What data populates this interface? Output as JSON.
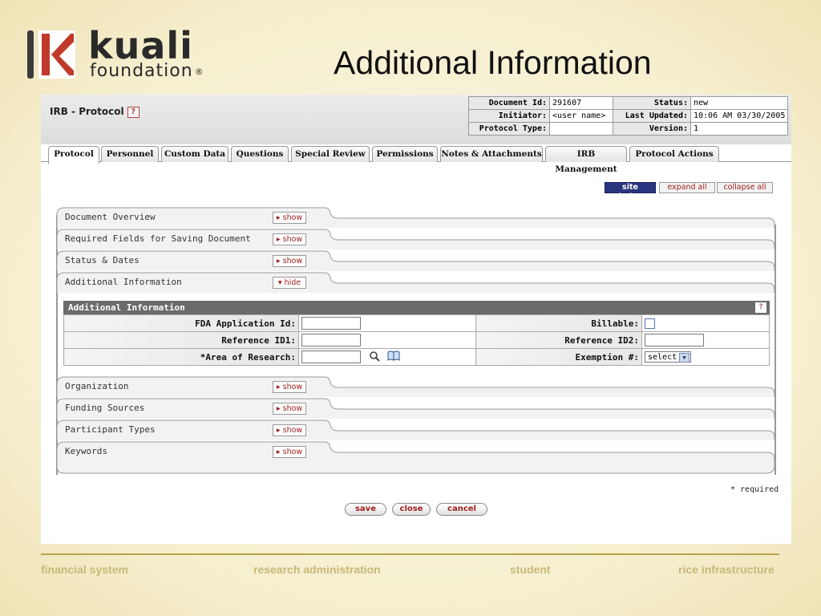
{
  "logo": {
    "brand": "kuali",
    "sub": "foundation",
    "reg": "®"
  },
  "slide_title": "Additional Information",
  "document": {
    "title": "IRB - Protocol",
    "help": "?",
    "info": [
      {
        "label": "Document Id:",
        "value": "291607",
        "label2": "Status:",
        "value2": "new"
      },
      {
        "label": "Initiator:",
        "value": "<user name>",
        "label2": "Last Updated:",
        "value2": "10:06 AM 03/30/2005"
      },
      {
        "label": "Protocol Type:",
        "value": "",
        "label2": "Version:",
        "value2": "1"
      }
    ]
  },
  "tabs": [
    "Protocol",
    "Personnel",
    "Custom Data",
    "Questions",
    "Special Review",
    "Permissions",
    "Notes & Attachments",
    "IRB Management",
    "Protocol Actions"
  ],
  "top_buttons": {
    "site_index": "site index",
    "expand_all": "expand all",
    "collapse_all": "collapse all"
  },
  "sections": [
    {
      "label": "Document Overview",
      "toggle": "▸ show"
    },
    {
      "label": "Required Fields for Saving Document",
      "toggle": "▸ show"
    },
    {
      "label": "Status & Dates",
      "toggle": "▸ show"
    },
    {
      "label": "Additional Information",
      "toggle": "▾ hide"
    },
    {
      "label": "Organization",
      "toggle": "▸ show"
    },
    {
      "label": "Funding Sources",
      "toggle": "▸ show"
    },
    {
      "label": "Participant Types",
      "toggle": "▸ show"
    },
    {
      "label": "Keywords",
      "toggle": "▸ show"
    }
  ],
  "additional_info": {
    "title": "Additional Information",
    "help": "?",
    "fda_label": "FDA Application Id:",
    "billable_label": "Billable:",
    "ref1_label": "Reference ID1:",
    "ref2_label": "Reference ID2:",
    "area_label": "*Area of Research:",
    "exemption_label": "Exemption #:",
    "exemption_value": "select"
  },
  "required_note": "* required",
  "actions": {
    "save": "save",
    "close": "close",
    "cancel": "cancel"
  },
  "footer": [
    "financial system",
    "research administration",
    "student",
    "rice infrastructure"
  ]
}
